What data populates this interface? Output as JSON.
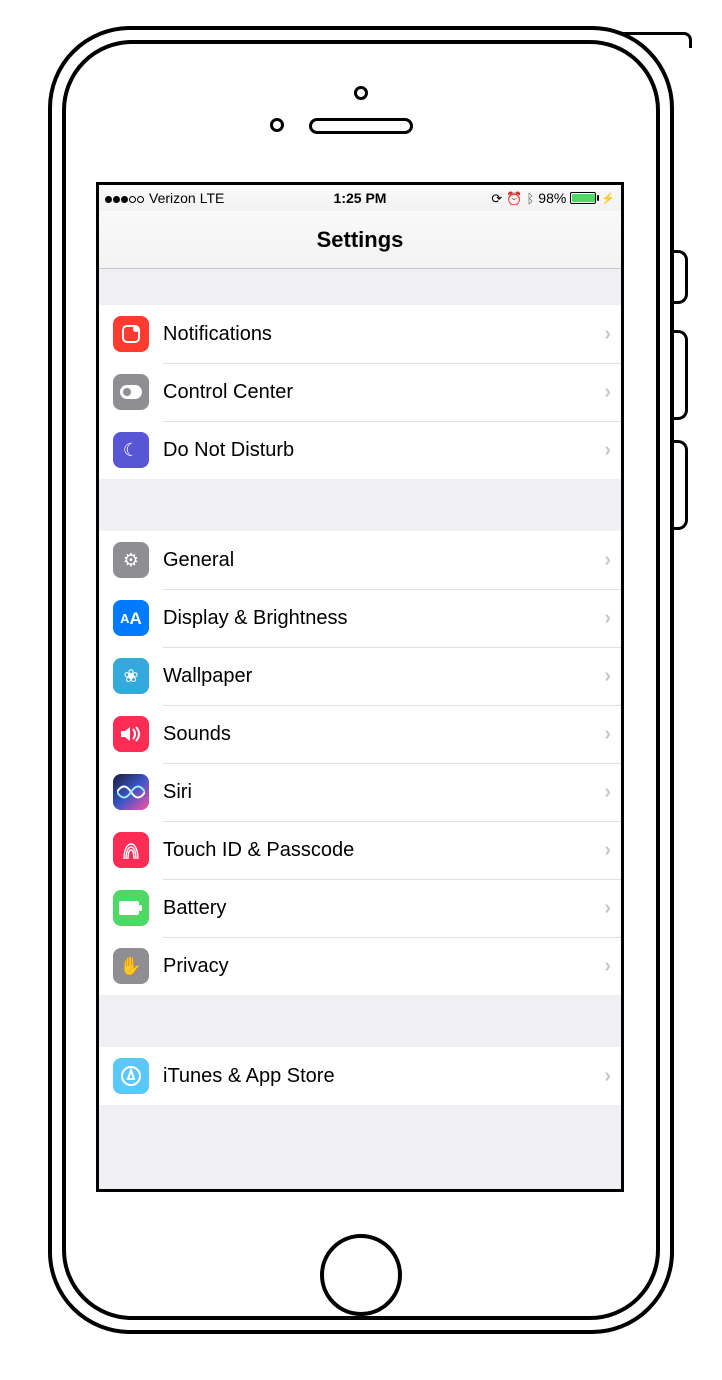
{
  "statusbar": {
    "carrier": "Verizon",
    "network": "LTE",
    "time": "1:25 PM",
    "battery_pct": "98%",
    "signal_dots_filled": 3,
    "signal_dots_total": 5,
    "indicators": [
      "rotation-lock",
      "alarm",
      "bluetooth"
    ]
  },
  "navbar": {
    "title": "Settings"
  },
  "groups": [
    {
      "id": "g1",
      "rows": [
        {
          "id": "notifications",
          "label": "Notifications"
        },
        {
          "id": "control-center",
          "label": "Control Center"
        },
        {
          "id": "do-not-disturb",
          "label": "Do Not Disturb"
        }
      ]
    },
    {
      "id": "g2",
      "rows": [
        {
          "id": "general",
          "label": "General"
        },
        {
          "id": "display-brightness",
          "label": "Display & Brightness"
        },
        {
          "id": "wallpaper",
          "label": "Wallpaper"
        },
        {
          "id": "sounds",
          "label": "Sounds"
        },
        {
          "id": "siri",
          "label": "Siri"
        },
        {
          "id": "touch-id-passcode",
          "label": "Touch ID & Passcode"
        },
        {
          "id": "battery",
          "label": "Battery"
        },
        {
          "id": "privacy",
          "label": "Privacy"
        }
      ]
    },
    {
      "id": "g3",
      "rows": [
        {
          "id": "itunes-app-store",
          "label": "iTunes & App Store"
        }
      ]
    }
  ]
}
